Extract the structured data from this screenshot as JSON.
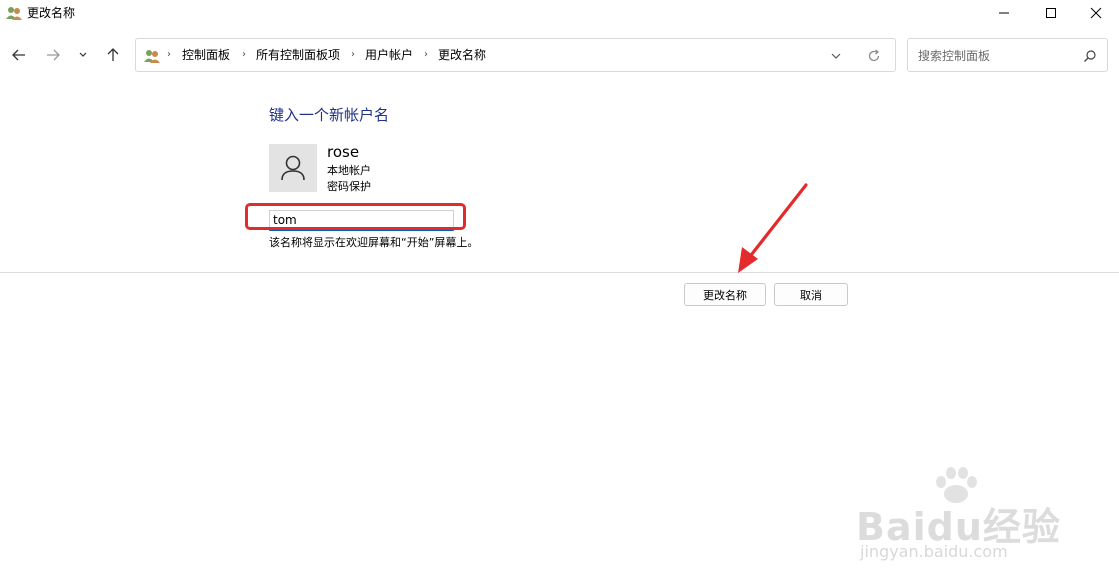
{
  "window": {
    "title": "更改名称",
    "icon": "users-icon"
  },
  "nav": {
    "back_icon": "arrow-left-icon",
    "forward_icon": "arrow-right-icon",
    "recent_icon": "chevron-down-icon",
    "up_icon": "arrow-up-icon"
  },
  "address_bar": {
    "crumbs": [
      "控制面板",
      "所有控制面板项",
      "用户帐户",
      "更改名称"
    ],
    "separator": "›"
  },
  "search": {
    "placeholder": "搜索控制面板"
  },
  "content": {
    "heading": "键入一个新帐户名",
    "user": {
      "name": "rose",
      "type": "本地帐户",
      "protection": "密码保护"
    },
    "new_name_value": "tom",
    "hint": "该名称将显示在欢迎屏幕和“开始”屏幕上。"
  },
  "buttons": {
    "change": "更改名称",
    "cancel": "取消"
  },
  "watermark": {
    "logo_text": "Baidu经验",
    "sub_text": "jingyan.baidu.com"
  },
  "colors": {
    "heading": "#1e3287",
    "highlight_box": "#e32b2b",
    "annotation_arrow": "#e32b2b",
    "input_underline": "#005fb8"
  }
}
